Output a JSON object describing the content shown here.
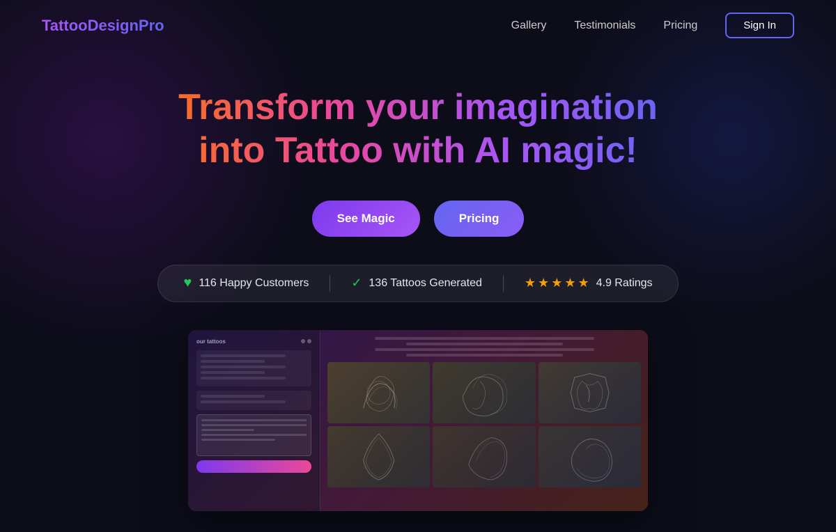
{
  "brand": {
    "name": "TattooDesignPro"
  },
  "nav": {
    "links": [
      {
        "label": "Gallery",
        "id": "gallery"
      },
      {
        "label": "Testimonials",
        "id": "testimonials"
      },
      {
        "label": "Pricing",
        "id": "pricing"
      }
    ],
    "signin_label": "Sign In"
  },
  "hero": {
    "title": "Transform your imagination into Tattoo with AI magic!",
    "buttons": {
      "magic_label": "See Magic",
      "pricing_label": "Pricing"
    }
  },
  "stats": {
    "customers_label": "116 Happy Customers",
    "tattoos_label": "136 Tattoos Generated",
    "rating_value": "4.9",
    "rating_label": "Ratings",
    "full_rating_label": "4.9 Ratings"
  },
  "icons": {
    "heart": "♥",
    "check": "✓",
    "star_filled": "★",
    "star_empty": "☆"
  }
}
